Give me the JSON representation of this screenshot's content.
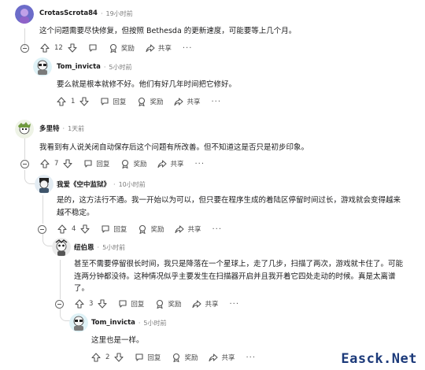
{
  "comments": [
    {
      "author": "CrotasScrota84",
      "time": "19小时前",
      "body": "这个问题需要尽快修复，但按照 Bethesda 的更新速度，可能要等上几个月。",
      "votes": "12",
      "award_label": "奖励",
      "share_label": "共享",
      "reply_label": null
    },
    {
      "author": "Tom_invicta",
      "time": "5小时前",
      "body": "要么就是根本就修不好。他们有好几年时间把它修好。",
      "votes": "1",
      "reply_label": "回复",
      "award_label": "奖励",
      "share_label": "共享"
    },
    {
      "author": "多里特",
      "time": "1天前",
      "body": "我看到有人说关闭自动保存后这个问题有所改善。但不知道这是否只是初步印象。",
      "votes": "7",
      "reply_label": "回复",
      "award_label": "奖励",
      "share_label": "共享"
    },
    {
      "author": "我爱《空中监狱》",
      "time": "10小时前",
      "body_lines": [
        "是的，这方法行不通。我一开始以为可以，但只要在程序生成的着陆区停留时间过长，游戏就会变得越来",
        "越不稳定。"
      ],
      "votes": "4",
      "reply_label": "回复",
      "award_label": "奖励",
      "share_label": "共享"
    },
    {
      "author": "纽伯恩",
      "time": "5小时前",
      "body_lines": [
        "甚至不需要停留很长时间，我只是降落在一个星球上，走了几步，扫描了两次，游戏就卡住了。可能",
        "连两分钟都没待。这种情况似乎主要发生在扫描器开启并且我开着它四处走动的时候。真是太离谱",
        "了。"
      ],
      "votes": "3",
      "reply_label": "回复",
      "award_label": "奖励",
      "share_label": "共享"
    },
    {
      "author": "Tom_invicta",
      "time": "5小时前",
      "body": "这里也是一样。",
      "votes": "2",
      "reply_label": "回复",
      "award_label": "奖励",
      "share_label": "共享"
    }
  ],
  "separator": "·",
  "watermark": "Easck.Net",
  "colors": {
    "meta": "#7c7c7c",
    "text": "#1a1a1b",
    "thread": "#d8d8d8",
    "watermark": "#1c3a7a"
  }
}
